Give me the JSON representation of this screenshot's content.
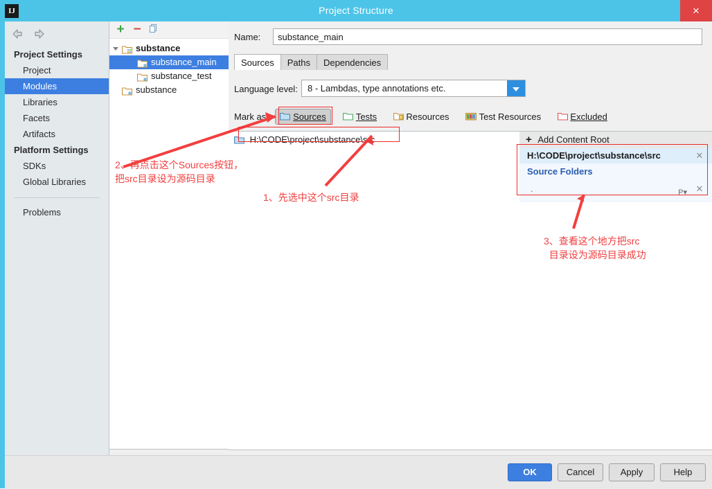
{
  "window": {
    "title": "Project Structure",
    "app_icon": "IJ",
    "close_label": "×"
  },
  "sidebar": {
    "nav": {
      "back": "back-arrow",
      "forward": "forward-arrow"
    },
    "sections": [
      {
        "title": "Project Settings",
        "items": [
          {
            "label": "Project",
            "selected": false
          },
          {
            "label": "Modules",
            "selected": true
          },
          {
            "label": "Libraries",
            "selected": false
          },
          {
            "label": "Facets",
            "selected": false
          },
          {
            "label": "Artifacts",
            "selected": false
          }
        ]
      },
      {
        "title": "Platform Settings",
        "items": [
          {
            "label": "SDKs",
            "selected": false
          },
          {
            "label": "Global Libraries",
            "selected": false
          }
        ]
      }
    ],
    "extra_items": [
      {
        "label": "Problems",
        "selected": false
      }
    ]
  },
  "module_panel": {
    "toolbar": {
      "add": "+",
      "remove": "−",
      "copy": "copy-icon"
    },
    "tree": [
      {
        "label": "substance",
        "indent": 22,
        "bold": true,
        "twisty": "open",
        "selected": false,
        "icon": "module-group-folder"
      },
      {
        "label": "substance_main",
        "indent": 44,
        "bold": false,
        "twisty": "none",
        "selected": true,
        "icon": "module-folder"
      },
      {
        "label": "substance_test",
        "indent": 44,
        "bold": false,
        "twisty": "none",
        "selected": false,
        "icon": "module-folder"
      },
      {
        "label": "substance",
        "indent": 22,
        "bold": false,
        "twisty": "none",
        "selected": false,
        "icon": "module-folder"
      }
    ]
  },
  "main": {
    "name_label": "Name:",
    "name_value": "substance_main",
    "name_placeholder": "",
    "tabs": [
      {
        "label": "Sources",
        "active": true
      },
      {
        "label": "Paths",
        "active": false
      },
      {
        "label": "Dependencies",
        "active": false
      }
    ],
    "language_level": {
      "label": "Language level:",
      "value": "8 - Lambdas, type annotations etc."
    },
    "mark_as": {
      "label": "Mark as:",
      "buttons": [
        {
          "label": "Sources",
          "icon": "sources-folder-icon",
          "pressed": true
        },
        {
          "label": "Tests",
          "icon": "tests-folder-icon",
          "pressed": false
        },
        {
          "label": "Resources",
          "icon": "resources-folder-icon",
          "pressed": false
        },
        {
          "label": "Test Resources",
          "icon": "test-resources-folder-icon",
          "pressed": false
        },
        {
          "label": "Excluded",
          "icon": "excluded-folder-icon",
          "pressed": false
        }
      ]
    },
    "source_list": [
      {
        "label": "H:\\CODE\\project\\substance\\src",
        "icon": "source-folder-icon"
      }
    ],
    "content_root": {
      "add_label": "Add Content Root",
      "root_path": "H:\\CODE\\project\\substance\\src",
      "source_folders_title": "Source Folders",
      "folders": [
        {
          "label": ".",
          "package_prefix_icon": "package-prefix-icon",
          "remove_icon": "remove-icon"
        }
      ],
      "remove_icon": "remove-icon"
    }
  },
  "buttons": [
    {
      "label": "OK",
      "primary": true
    },
    {
      "label": "Cancel",
      "primary": false
    },
    {
      "label": "Apply",
      "primary": false
    },
    {
      "label": "Help",
      "primary": false
    }
  ],
  "annotations": [
    {
      "id": "anno-2",
      "line1": "2、再点击这个Sources按钮，",
      "line2": "把src目录设为源码目录"
    },
    {
      "id": "anno-1",
      "line1": "1、先选中这个src目录",
      "line2": ""
    },
    {
      "id": "anno-3",
      "line1": "3、查看这个地方把src",
      "line2": "目录设为源码目录成功"
    }
  ],
  "colors": {
    "titlebar": "#4cc4e8",
    "accent_selection": "#3d7fe0",
    "annotation_red": "#f23f3f",
    "close_red": "#e04343"
  }
}
